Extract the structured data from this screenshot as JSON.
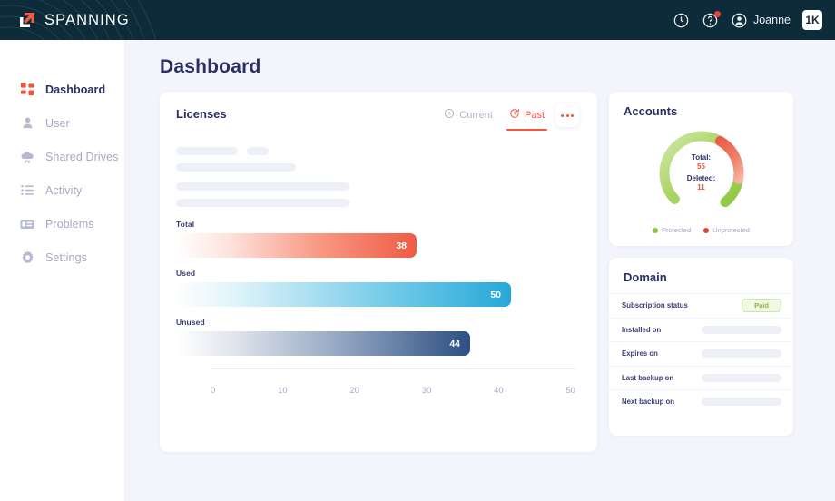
{
  "header": {
    "logo_text": "SPANNING",
    "logo_icon": "spanning-arrow-logo",
    "history_icon": "clock-icon",
    "help_icon": "help-circle-icon",
    "avatar_icon": "user-avatar-icon",
    "user_name": "Joanne",
    "app_badge": "1K",
    "background_color": "#0d2b38",
    "notification_color": "#ee4036"
  },
  "sidebar": {
    "items": [
      {
        "label": "Dashboard",
        "icon": "grid-squares-icon",
        "active": true
      },
      {
        "label": "User",
        "icon": "person-icon",
        "active": false
      },
      {
        "label": "Shared Drives",
        "icon": "cloud-drive-icon",
        "active": false
      },
      {
        "label": "Activity",
        "icon": "list-icon",
        "active": false
      },
      {
        "label": "Problems",
        "icon": "card-list-icon",
        "active": false
      },
      {
        "label": "Settings",
        "icon": "gear-icon",
        "active": false
      }
    ],
    "active_indicator_color": "#f4543c"
  },
  "main": {
    "page_title": "Dashboard"
  },
  "licenses": {
    "title": "Licenses",
    "tabs": [
      {
        "label": "Current",
        "icon": "clock-icon",
        "active": false
      },
      {
        "label": "Past",
        "icon": "history-refresh-icon",
        "active": true
      }
    ],
    "more_button": "more-options",
    "loading_placeholders": 5
  },
  "accounts": {
    "title": "Accounts",
    "center": {
      "total_label": "Total:",
      "total_value": "55",
      "deleted_label": "Deleted:",
      "deleted_value": "11"
    },
    "legend": [
      {
        "label": "Protected",
        "color": "#8cc63f"
      },
      {
        "label": "Unprotected",
        "color": "#e8402e"
      }
    ]
  },
  "domain": {
    "title": "Domain",
    "rows": [
      {
        "label": "Subscription status",
        "value": "Paid",
        "type": "badge"
      },
      {
        "label": "Installed on",
        "value": "",
        "type": "skeleton"
      },
      {
        "label": "Expires on",
        "value": "",
        "type": "skeleton"
      },
      {
        "label": "Last backup on",
        "value": "",
        "type": "skeleton"
      },
      {
        "label": "Next backup on",
        "value": "",
        "type": "skeleton"
      }
    ]
  },
  "chart_data": [
    {
      "type": "bar",
      "title": "Licenses",
      "orientation": "horizontal",
      "categories": [
        "Total",
        "Used",
        "Unused"
      ],
      "values": [
        38,
        50,
        44
      ],
      "bar_colors": [
        "#ef5b45",
        "#26a8d9",
        "#2d4f82"
      ],
      "xlabel": "",
      "ylabel": "",
      "xlim": [
        0,
        50
      ],
      "xticks": [
        "0",
        "10",
        "20",
        "30",
        "40",
        "50"
      ],
      "grid": false,
      "legend": "none",
      "value_labels_inside": true
    },
    {
      "type": "pie",
      "title": "Accounts",
      "subtype": "donut",
      "labels": [
        "Protected",
        "Unprotected"
      ],
      "values": [
        44,
        11
      ],
      "colors": [
        "#8cc63f",
        "#e8402e"
      ],
      "center_text": [
        "Total:",
        "55",
        "Deleted:",
        "11"
      ],
      "legend": "bottom"
    }
  ]
}
